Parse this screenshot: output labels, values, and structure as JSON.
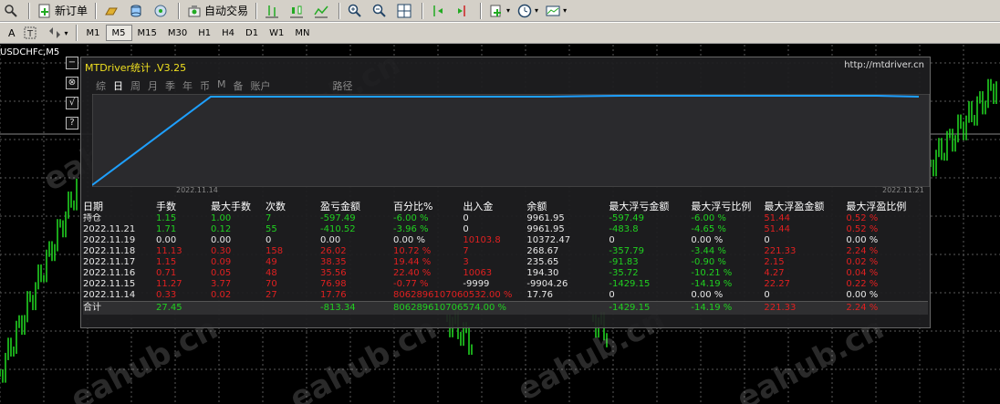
{
  "toolbar1": {
    "new_order_label": "新订单",
    "auto_trade_label": "自动交易"
  },
  "toolbar2": {
    "text_tool_label": "A",
    "timeframes": [
      "M1",
      "M5",
      "M15",
      "M30",
      "H1",
      "H4",
      "D1",
      "W1",
      "MN"
    ],
    "active_timeframe": "M5"
  },
  "chart": {
    "symbol_label": "USDCHFc,M5",
    "watermark": "eahub.cn"
  },
  "side_buttons": [
    "−",
    "⊗",
    "√",
    "?"
  ],
  "panel": {
    "title": "MTDriver统计 ,V3.25",
    "link": "http://mtdriver.cn",
    "tabs": [
      "综",
      "日",
      "周",
      "月",
      "季",
      "年",
      "币",
      "M",
      "备",
      "账户",
      "路径"
    ],
    "active_tab": "日",
    "graph_start_date": "2022.11.14",
    "graph_end_date": "2022.11.21",
    "equity_curve": [
      0,
      1,
      1,
      1,
      1,
      1,
      1.01,
      1.01,
      1.01,
      1.01,
      1.0
    ],
    "columns": [
      "日期",
      "手数",
      "最大手数",
      "次数",
      "盈亏金额",
      "百分比%",
      "出入金",
      "余额",
      "最大浮亏金额",
      "最大浮亏比例",
      "最大浮盈金额",
      "最大浮盈比例"
    ],
    "rows": [
      {
        "cells": [
          "持仓",
          "1.15",
          "1.00",
          "7",
          "-597.49",
          "-6.00 %",
          "0",
          "9961.95",
          "-597.49",
          "-6.00 %",
          "51.44",
          "0.52 %"
        ],
        "colors": [
          "w",
          "g",
          "g",
          "g",
          "g",
          "g",
          "w",
          "w",
          "g",
          "g",
          "r",
          "r"
        ]
      },
      {
        "cells": [
          "2022.11.21",
          "1.71",
          "0.12",
          "55",
          "-410.52",
          "-3.96 %",
          "0",
          "9961.95",
          "-483.8",
          "-4.65 %",
          "51.44",
          "0.52 %"
        ],
        "colors": [
          "w",
          "g",
          "g",
          "g",
          "g",
          "g",
          "w",
          "w",
          "g",
          "g",
          "r",
          "r"
        ]
      },
      {
        "cells": [
          "2022.11.19",
          "0.00",
          "0.00",
          "0",
          "0.00",
          "0.00 %",
          "10103.8",
          "10372.47",
          "0",
          "0.00 %",
          "0",
          "0.00 %"
        ],
        "colors": [
          "w",
          "w",
          "w",
          "w",
          "w",
          "w",
          "r",
          "w",
          "w",
          "w",
          "w",
          "w"
        ]
      },
      {
        "cells": [
          "2022.11.18",
          "11.13",
          "0.30",
          "158",
          "26.02",
          "10.72 %",
          "7",
          "268.67",
          "-357.79",
          "-3.44 %",
          "221.33",
          "2.24 %"
        ],
        "colors": [
          "w",
          "r",
          "r",
          "r",
          "r",
          "r",
          "r",
          "w",
          "g",
          "g",
          "r",
          "r"
        ]
      },
      {
        "cells": [
          "2022.11.17",
          "1.15",
          "0.09",
          "49",
          "38.35",
          "19.44 %",
          "3",
          "235.65",
          "-91.83",
          "-0.90 %",
          "2.15",
          "0.02 %"
        ],
        "colors": [
          "w",
          "r",
          "r",
          "r",
          "r",
          "r",
          "r",
          "w",
          "g",
          "g",
          "r",
          "r"
        ]
      },
      {
        "cells": [
          "2022.11.16",
          "0.71",
          "0.05",
          "48",
          "35.56",
          "22.40 %",
          "10063",
          "194.30",
          "-35.72",
          "-10.21 %",
          "4.27",
          "0.04 %"
        ],
        "colors": [
          "w",
          "r",
          "r",
          "r",
          "r",
          "r",
          "r",
          "w",
          "g",
          "g",
          "r",
          "r"
        ]
      },
      {
        "cells": [
          "2022.11.15",
          "11.27",
          "3.77",
          "70",
          "76.98",
          "-0.77 %",
          "-9999",
          "-9904.26",
          "-1429.15",
          "-14.19 %",
          "22.27",
          "0.22 %"
        ],
        "colors": [
          "w",
          "r",
          "r",
          "r",
          "r",
          "r",
          "w",
          "w",
          "g",
          "g",
          "r",
          "r"
        ]
      },
      {
        "cells": [
          "2022.11.14",
          "0.33",
          "0.02",
          "27",
          "17.76",
          "806289610706",
          "0532.00 %",
          "17.76",
          "0",
          "0.00 %",
          "0",
          "0.00 %"
        ],
        "colors": [
          "w",
          "r",
          "r",
          "r",
          "r",
          "r",
          "r",
          "w",
          "w",
          "w",
          "w",
          "w"
        ]
      }
    ],
    "total": {
      "cells": [
        "合计",
        "27.45",
        "",
        "",
        "-813.34",
        "806289610706",
        "574.00 %",
        "",
        "-1429.15",
        "-14.19 %",
        "221.33",
        "2.24 %"
      ],
      "colors": [
        "w",
        "g",
        "w",
        "w",
        "g",
        "g",
        "g",
        "w",
        "g",
        "g",
        "r",
        "r"
      ]
    }
  },
  "colors": {
    "profit": "#e02020",
    "loss": "#20d020",
    "title": "#f0e020",
    "curve": "#1ea0ff"
  }
}
